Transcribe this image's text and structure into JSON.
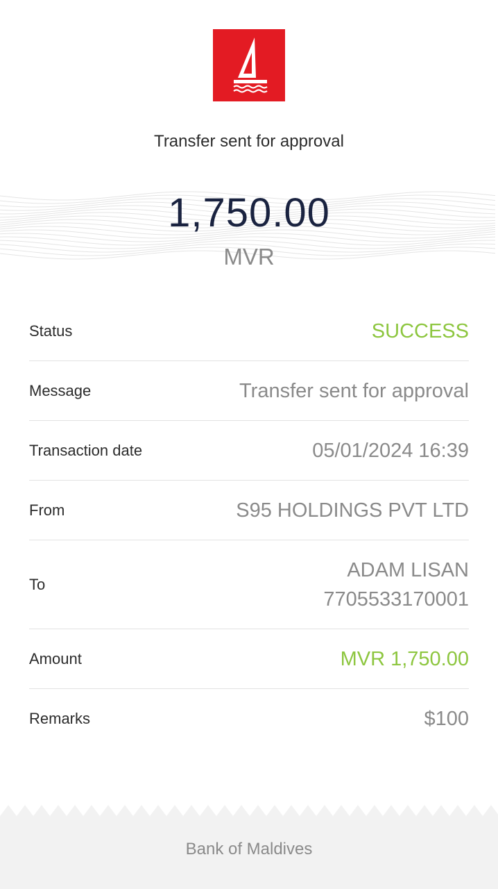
{
  "brand": {
    "logo_icon": "sailboat-logo-icon",
    "logo_color": "#e31b23"
  },
  "header": {
    "title": "Transfer sent for approval"
  },
  "amount": {
    "value": "1,750.00",
    "currency": "MVR"
  },
  "details": {
    "status": {
      "label": "Status",
      "value": "SUCCESS"
    },
    "message": {
      "label": "Message",
      "value": "Transfer sent for approval"
    },
    "transaction_date": {
      "label": "Transaction date",
      "value": "05/01/2024 16:39"
    },
    "from": {
      "label": "From",
      "value": "S95 HOLDINGS PVT LTD"
    },
    "to": {
      "label": "To",
      "name": "ADAM LISAN",
      "account": "7705533170001"
    },
    "amount": {
      "label": "Amount",
      "value": "MVR 1,750.00"
    },
    "remarks": {
      "label": "Remarks",
      "value": "$100"
    }
  },
  "footer": {
    "text": "Bank of Maldives"
  },
  "colors": {
    "accent_green": "#8dc63f",
    "brand_red": "#e31b23",
    "amount_navy": "#1a2340"
  }
}
